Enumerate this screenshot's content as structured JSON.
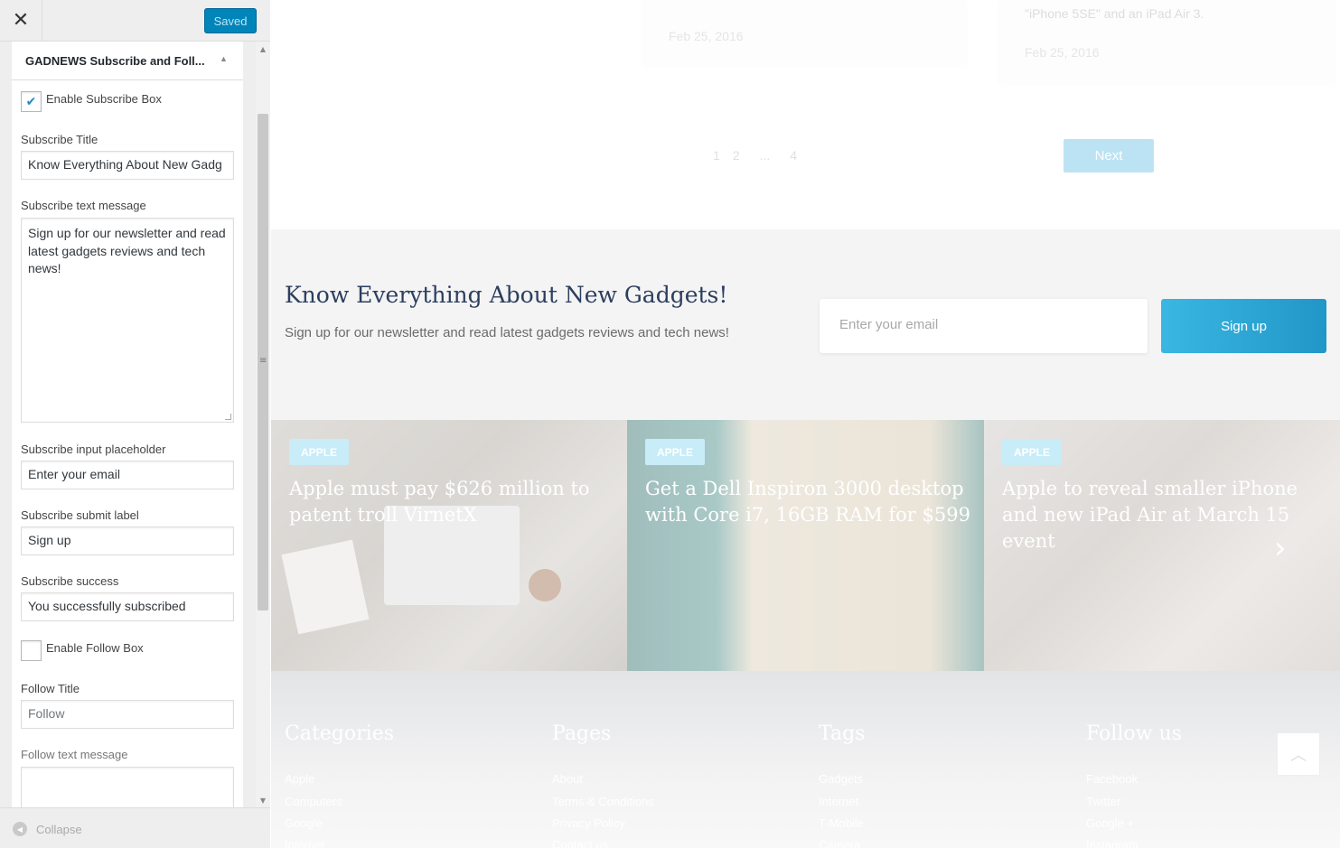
{
  "panel": {
    "close_glyph": "✕",
    "saved_label": "Saved",
    "section_title": "GADNEWS Subscribe and Foll...",
    "enable_subscribe": {
      "label": "Enable Subscribe Box",
      "checked": true,
      "check_glyph": "✔"
    },
    "subscribe_title": {
      "label": "Subscribe Title",
      "value": "Know Everything About New Gadg"
    },
    "subscribe_text": {
      "label": "Subscribe text message",
      "value": "Sign up for our newsletter and read latest gadgets reviews and tech news!"
    },
    "subscribe_placeholder": {
      "label": "Subscribe input placeholder",
      "value": "Enter your email"
    },
    "subscribe_submit": {
      "label": "Subscribe submit label",
      "value": "Sign up"
    },
    "subscribe_success": {
      "label": "Subscribe success",
      "value": "You successfully subscribed"
    },
    "enable_follow": {
      "label": "Enable Follow Box",
      "checked": false
    },
    "follow_title": {
      "label": "Follow Title",
      "value": "Follow"
    },
    "follow_text": {
      "label": "Follow text message",
      "value": ""
    },
    "collapse_label": "Collapse",
    "collapse_glyph": "◀",
    "scroll_up_glyph": "▲",
    "scroll_down_glyph": "▼",
    "splitter_glyph": "≡"
  },
  "preview": {
    "posts": [
      {
        "snippet": "",
        "date": "Feb 25, 2016"
      },
      {
        "snippet": "\"iPhone 5SE\" and an iPad Air 3.",
        "date": "Feb 25, 2016"
      }
    ],
    "pagination": [
      "1",
      "2",
      "...",
      "4"
    ],
    "next_label": "Next",
    "subscribe": {
      "title": "Know Everything About New Gadgets!",
      "text": "Sign up for our newsletter and read latest gadgets reviews and tech news!",
      "placeholder": "Enter your email",
      "button": "Sign up"
    },
    "slides": [
      {
        "badge": "APPLE",
        "title": "Apple must pay $626 million to patent troll VirnetX"
      },
      {
        "badge": "APPLE",
        "title": "Get a Dell Inspiron 3000 desktop with Core i7, 16GB RAM for $599"
      },
      {
        "badge": "APPLE",
        "title": "Apple to reveal smaller iPhone and new iPad Air at March 15 event"
      }
    ],
    "slider_next_glyph": "›",
    "footer": {
      "categories": {
        "heading": "Categories",
        "links": [
          "Apple",
          "Computers",
          "Google",
          "Internet"
        ]
      },
      "pages": {
        "heading": "Pages",
        "links": [
          "About",
          "Terms & Conditions",
          "Privacy Policy",
          "Contact us"
        ]
      },
      "tags": {
        "heading": "Tags",
        "links": [
          "Gadgets",
          "Internet",
          "T-Mobile",
          "Camera"
        ]
      },
      "follow": {
        "heading": "Follow us",
        "links": [
          "Facebook",
          "Twitter",
          "Google +",
          "Instagram"
        ]
      }
    },
    "back_to_top_glyph": "︿"
  },
  "colors": {
    "saved_button": "#0085ba",
    "signup_button": "#2aa8d8",
    "badge": "#c8ecf8",
    "subscribe_title": "#2c3e5f"
  }
}
